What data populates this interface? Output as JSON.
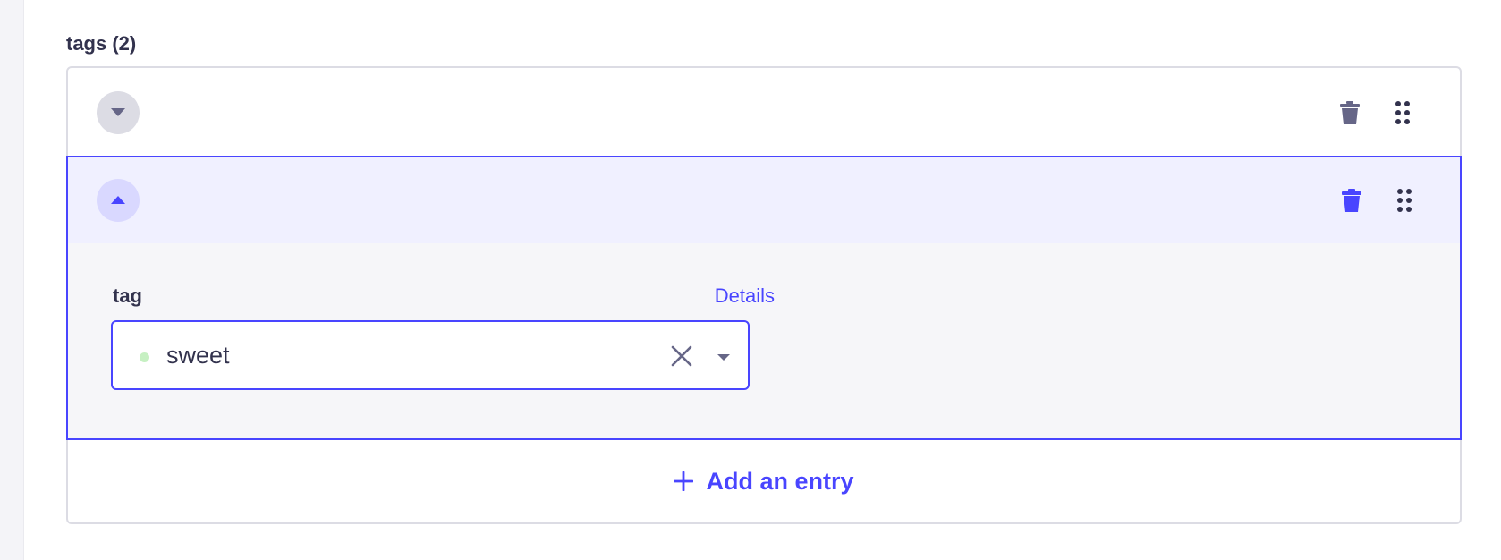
{
  "field": {
    "label": "tags (2)"
  },
  "entries": [
    {
      "state": "collapsed",
      "toggle_icon": "chevron-down-icon"
    },
    {
      "state": "expanded",
      "toggle_icon": "chevron-up-icon",
      "tag_field": {
        "label": "tag",
        "details_link": "Details",
        "value": "sweet",
        "status_color": "#c6f0c2"
      }
    }
  ],
  "actions": {
    "add_entry_label": "Add an entry"
  },
  "colors": {
    "accent": "#4945ff",
    "text": "#32324d",
    "muted_icon": "#666687",
    "expanded_header_bg": "#f0f0ff",
    "expanded_body_bg": "#f6f6f9"
  }
}
